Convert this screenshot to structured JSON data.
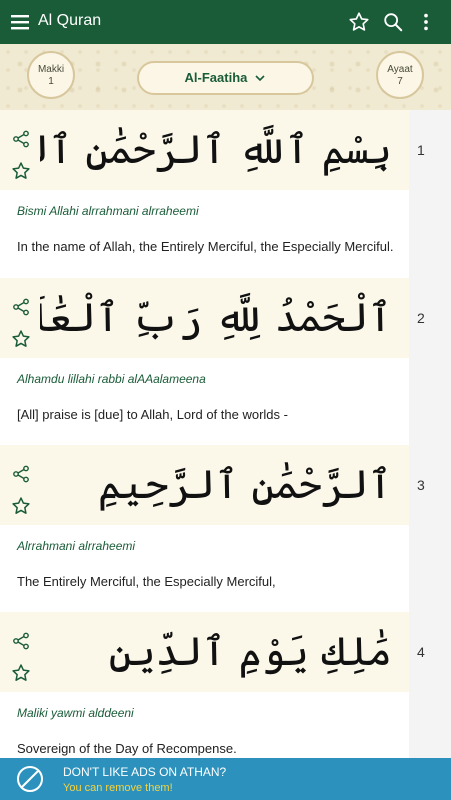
{
  "appbar": {
    "title": "Al Quran",
    "icons": [
      "menu-icon",
      "star-icon",
      "search-icon",
      "more-vert-icon"
    ],
    "bg_color": "#1a5c38"
  },
  "header": {
    "revelation_label": "Makki",
    "revelation_value": "1",
    "surah_name": "Al-Faatiha",
    "ayaat_label": "Ayaat",
    "ayaat_value": "7"
  },
  "verses": [
    {
      "number": "1",
      "arabic": "بِسْمِ ٱللَّهِ ٱلرَّحْمَٰنِ ٱلرَّحِيمِ",
      "transliteration": "Bismi Allahi alrrahmani alrraheemi",
      "translation": "In the name of Allah, the Entirely Merciful, the Especially Merciful."
    },
    {
      "number": "2",
      "arabic": "ٱلْحَمْدُ لِلَّهِ رَبِّ ٱلْعَٰلَمِينَ",
      "transliteration": "Alhamdu lillahi rabbi alAAalameena",
      "translation": "[All] praise is [due] to Allah, Lord of the worlds -"
    },
    {
      "number": "3",
      "arabic": "ٱلرَّحْمَٰنِ ٱلرَّحِيمِ",
      "transliteration": "Alrrahmani alrraheemi",
      "translation": "The Entirely Merciful, the Especially Merciful,"
    },
    {
      "number": "4",
      "arabic": "مَٰلِكِ يَوْمِ ٱلدِّينِ",
      "transliteration": "Maliki yawmi alddeeni",
      "translation": "Sovereign of the Day of Recompense."
    }
  ],
  "ad": {
    "headline": "DON'T LIKE ADS ON ATHAN?",
    "subline": "You can remove them!",
    "icon": "no-ads-icon",
    "bg_color": "#2c92bd",
    "subline_color": "#f6d33d"
  }
}
